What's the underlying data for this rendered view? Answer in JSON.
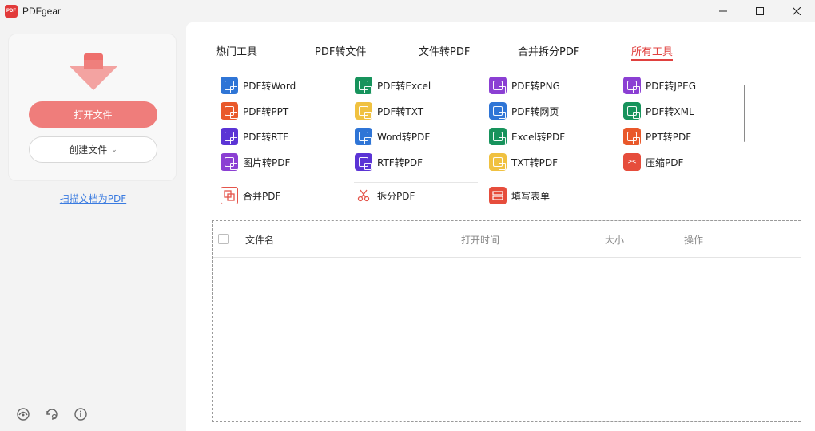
{
  "app": {
    "title": "PDFgear",
    "logo_text": "PDF"
  },
  "sidebar": {
    "open_button": "打开文件",
    "create_button": "创建文件",
    "scan_link": "扫描文档为PDF"
  },
  "tabs": [
    {
      "label": "热门工具",
      "active": false
    },
    {
      "label": "PDF转文件",
      "active": false
    },
    {
      "label": "文件转PDF",
      "active": false
    },
    {
      "label": "合并拆分PDF",
      "active": false
    },
    {
      "label": "所有工具",
      "active": true
    }
  ],
  "tools": [
    {
      "label": "PDF转Word",
      "color": "#2f75d6"
    },
    {
      "label": "PDF转Excel",
      "color": "#17935c"
    },
    {
      "label": "PDF转PNG",
      "color": "#8b3fd3"
    },
    {
      "label": "PDF转JPEG",
      "color": "#8b3fd3"
    },
    {
      "label": "PDF转PPT",
      "color": "#e9582a"
    },
    {
      "label": "PDF转TXT",
      "color": "#f0c140"
    },
    {
      "label": "PDF转网页",
      "color": "#2f75d6"
    },
    {
      "label": "PDF转XML",
      "color": "#17935c"
    },
    {
      "label": "PDF转RTF",
      "color": "#5b34d5"
    },
    {
      "label": "Word转PDF",
      "color": "#2f75d6"
    },
    {
      "label": "Excel转PDF",
      "color": "#17935c"
    },
    {
      "label": "PPT转PDF",
      "color": "#e9582a"
    },
    {
      "label": "图片转PDF",
      "color": "#8b3fd3"
    },
    {
      "label": "RTF转PDF",
      "color": "#5b34d5"
    },
    {
      "label": "TXT转PDF",
      "color": "#f0c140"
    },
    {
      "label": "压缩PDF",
      "color": "#e64d3c"
    }
  ],
  "extra_tools": [
    {
      "label": "合并PDF"
    },
    {
      "label": "拆分PDF"
    },
    {
      "label": "填写表单"
    }
  ],
  "files_table": {
    "columns": [
      "文件名",
      "打开时间",
      "大小",
      "操作"
    ]
  },
  "colors": {
    "accent": "#e0413f",
    "primary_button": "#ef7d7b",
    "link": "#3a7be0"
  }
}
